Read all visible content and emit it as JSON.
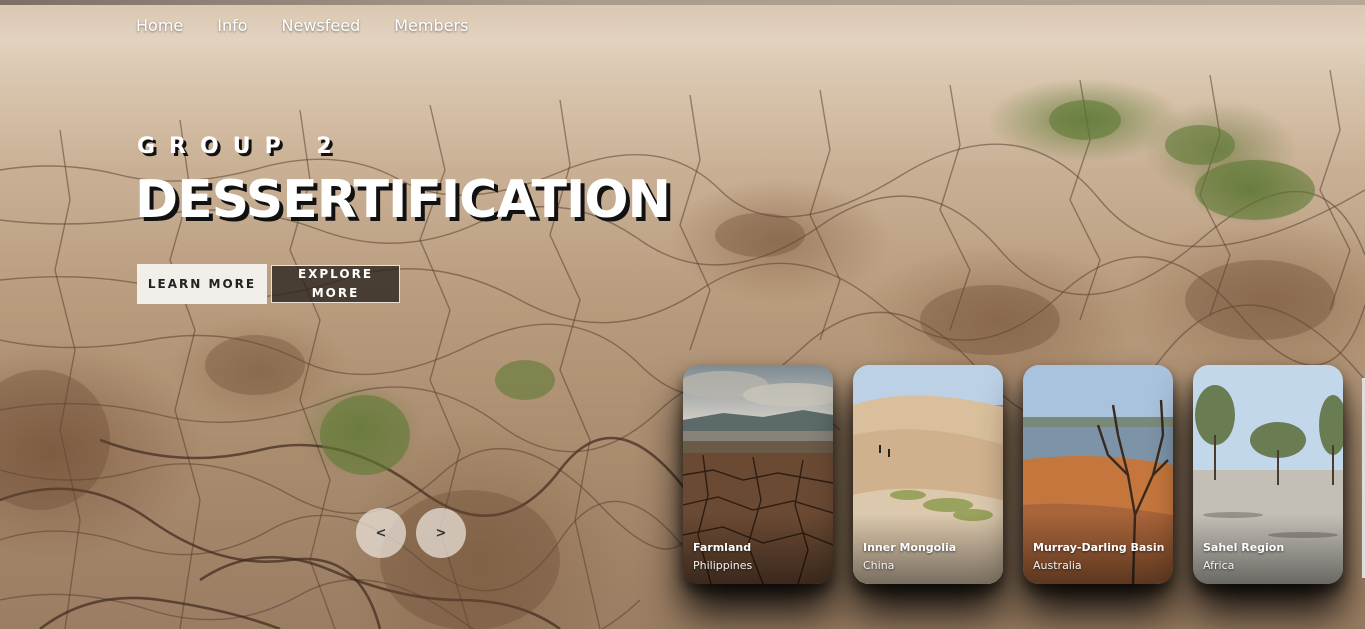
{
  "nav": {
    "items": [
      "Home",
      "Info",
      "Newsfeed",
      "Members"
    ]
  },
  "hero": {
    "subtitle": "GROUP 2",
    "title": "DESSERTIFICATION",
    "learn_more": "LEARN MORE",
    "explore_more": "EXPLORE MORE"
  },
  "slider": {
    "prev": "<",
    "next": ">"
  },
  "cards": [
    {
      "name": "Farmland",
      "location": "Philippines"
    },
    {
      "name": "Inner Mongolia",
      "location": "China"
    },
    {
      "name": "Murray-Darling Basin",
      "location": "Australia"
    },
    {
      "name": "Sahel Region",
      "location": "Africa"
    }
  ],
  "colors": {
    "text": "#ffffff",
    "title_shadow": "#111111",
    "learn_button_bg": "#f2efea",
    "explore_button_bg": "#28221e"
  }
}
